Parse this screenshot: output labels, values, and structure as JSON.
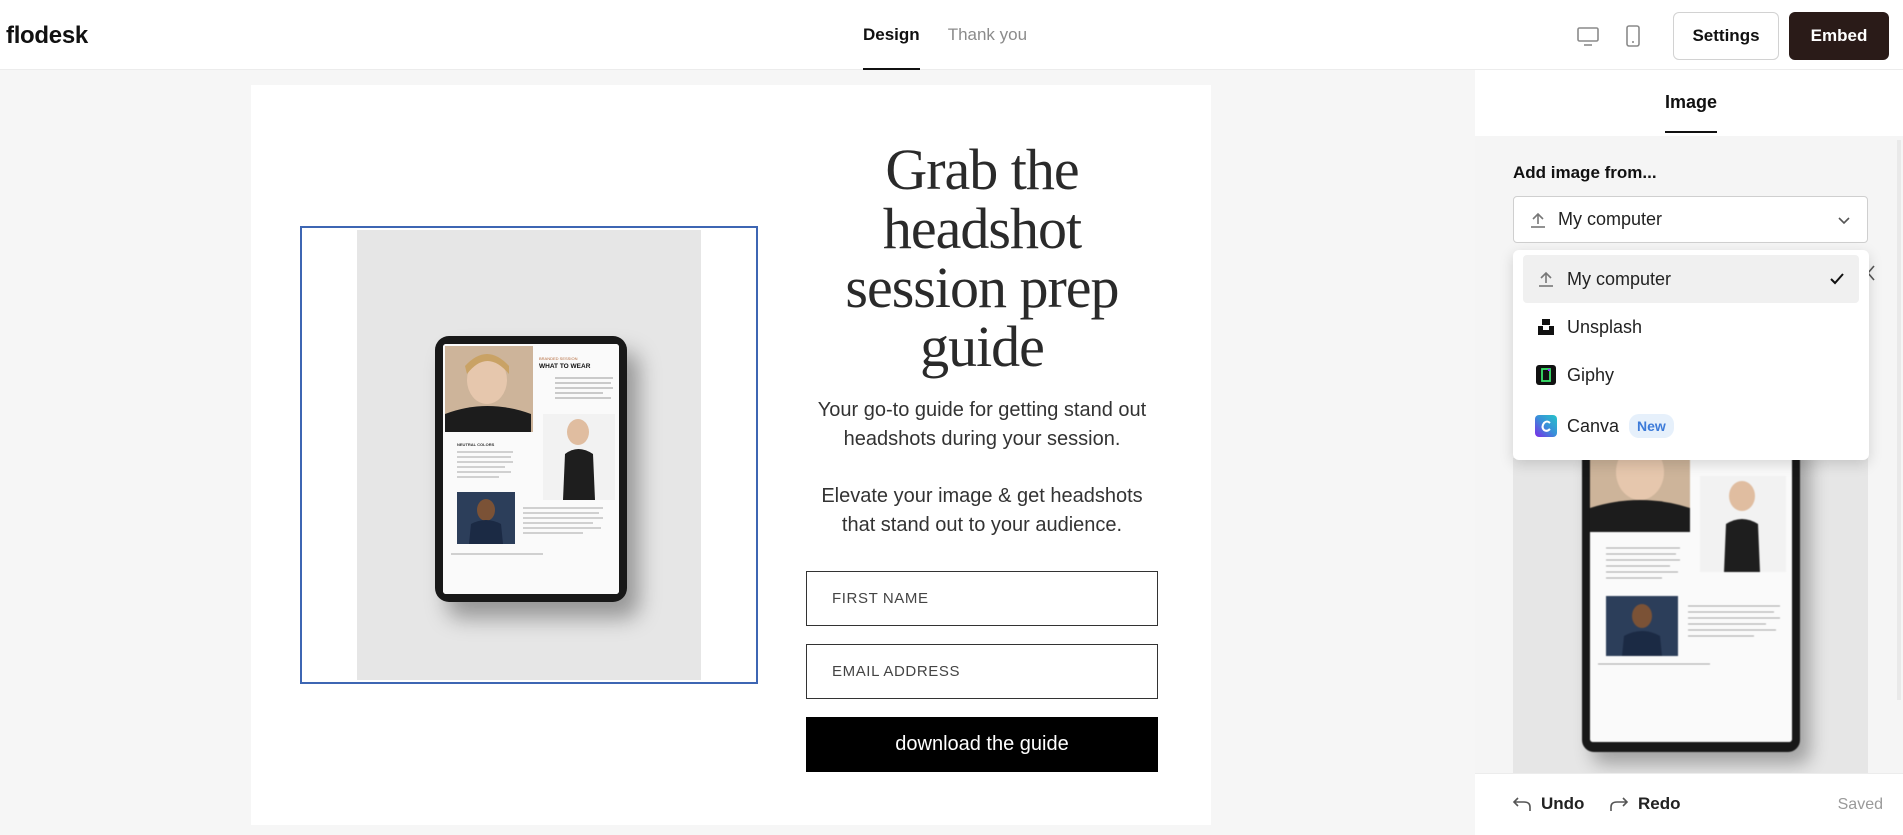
{
  "app": {
    "logo": "flodesk"
  },
  "header": {
    "tabs": [
      {
        "label": "Design",
        "active": true
      },
      {
        "label": "Thank you",
        "active": false
      }
    ],
    "settings_label": "Settings",
    "embed_label": "Embed"
  },
  "form": {
    "headline": "Grab the headshot session prep guide",
    "paragraph1": "Your go-to guide for getting stand out headshots during your session.",
    "paragraph2": "Elevate your image & get headshots that stand out to your audience.",
    "first_name_placeholder": "FIRST NAME",
    "email_placeholder": "EMAIL ADDRESS",
    "cta_label": "download the guide",
    "tablet_text": {
      "kicker": "BRANDED SESSION",
      "title": "WHAT TO WEAR",
      "section": "NEUTRAL COLORS"
    }
  },
  "panel": {
    "tab_label": "Image",
    "add_label": "Add image from...",
    "selected_source": "My computer",
    "options": [
      {
        "label": "My computer",
        "icon": "upload-icon",
        "selected": true
      },
      {
        "label": "Unsplash",
        "icon": "unsplash-icon",
        "selected": false
      },
      {
        "label": "Giphy",
        "icon": "giphy-icon",
        "selected": false
      },
      {
        "label": "Canva",
        "icon": "canva-icon",
        "selected": false,
        "badge": "New"
      }
    ],
    "undo_label": "Undo",
    "redo_label": "Redo",
    "status": "Saved"
  },
  "colors": {
    "accent_dark": "#2a1b18",
    "selection_border": "#3d66b3",
    "badge_bg": "#e6f0fb",
    "badge_text": "#3d7bd9"
  }
}
